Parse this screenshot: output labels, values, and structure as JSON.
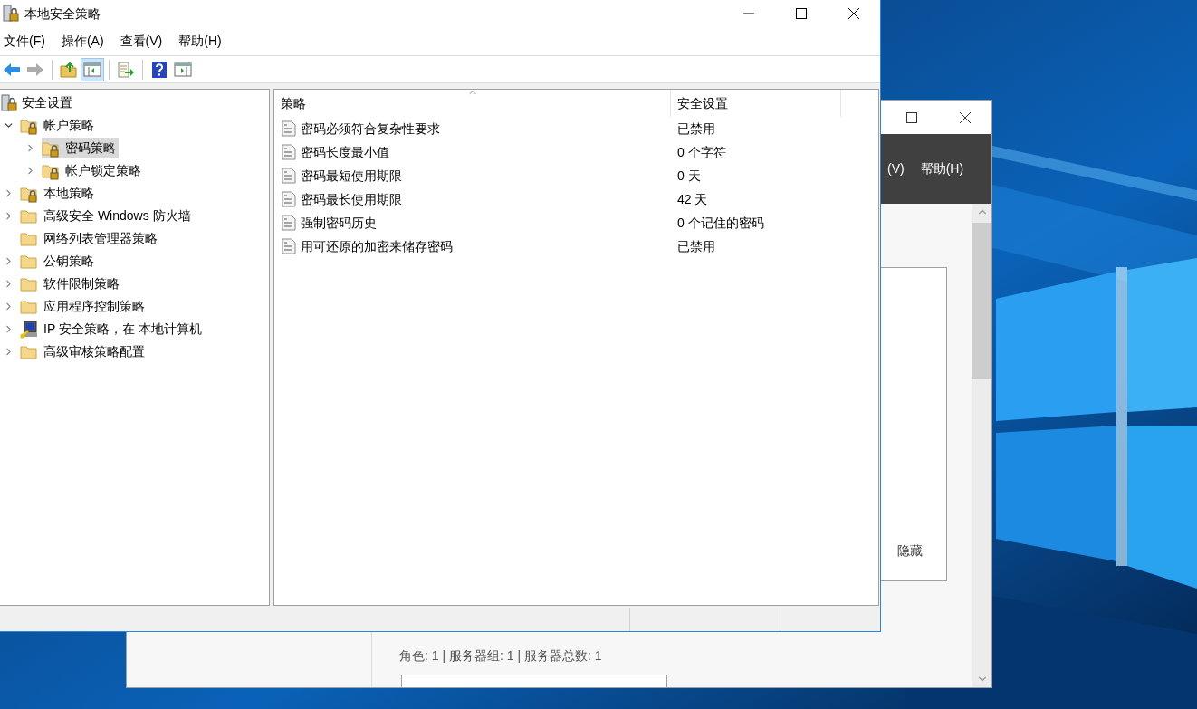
{
  "window": {
    "title": "本地安全策略"
  },
  "menu": [
    "文件(F)",
    "操作(A)",
    "查看(V)",
    "帮助(H)"
  ],
  "toolbar": [
    {
      "kind": "back",
      "disabled": false,
      "selected": false
    },
    {
      "kind": "forward",
      "disabled": true,
      "selected": false
    },
    {
      "kind": "separator"
    },
    {
      "kind": "up",
      "disabled": false,
      "selected": false
    },
    {
      "kind": "tree",
      "disabled": false,
      "selected": true
    },
    {
      "kind": "separator"
    },
    {
      "kind": "export",
      "disabled": false,
      "selected": false
    },
    {
      "kind": "separator"
    },
    {
      "kind": "help",
      "disabled": false,
      "selected": false
    },
    {
      "kind": "pane",
      "disabled": false,
      "selected": false
    }
  ],
  "tree": {
    "root": {
      "label": "安全设置",
      "kind": "server"
    },
    "items": [
      {
        "label": "帐户策略",
        "kind": "lock-folder",
        "expandable": true,
        "expanded": true,
        "selected": false,
        "children": [
          {
            "label": "密码策略",
            "kind": "lock-folder",
            "expandable": true,
            "expanded": false,
            "selected": true
          },
          {
            "label": "帐户锁定策略",
            "kind": "lock-folder",
            "expandable": true,
            "expanded": false,
            "selected": false
          }
        ]
      },
      {
        "label": "本地策略",
        "kind": "lock-folder",
        "expandable": true,
        "expanded": false,
        "selected": false
      },
      {
        "label": "高级安全 Windows 防火墙",
        "kind": "folder",
        "expandable": true,
        "expanded": false,
        "selected": false
      },
      {
        "label": "网络列表管理器策略",
        "kind": "folder",
        "expandable": false,
        "selected": false
      },
      {
        "label": "公钥策略",
        "kind": "folder",
        "expandable": true,
        "expanded": false,
        "selected": false
      },
      {
        "label": "软件限制策略",
        "kind": "folder",
        "expandable": true,
        "expanded": false,
        "selected": false
      },
      {
        "label": "应用程序控制策略",
        "kind": "folder",
        "expandable": true,
        "expanded": false,
        "selected": false
      },
      {
        "label": "IP 安全策略，在 本地计算机",
        "kind": "network",
        "expandable": true,
        "expanded": false,
        "selected": false
      },
      {
        "label": "高级审核策略配置",
        "kind": "folder",
        "expandable": true,
        "expanded": false,
        "selected": false
      }
    ]
  },
  "list": {
    "columns": [
      {
        "label": "策略",
        "sorted": true
      },
      {
        "label": "安全设置",
        "sorted": false
      }
    ],
    "rows": [
      {
        "policy": "密码必须符合复杂性要求",
        "setting": "已禁用"
      },
      {
        "policy": "密码长度最小值",
        "setting": "0 个字符"
      },
      {
        "policy": "密码最短使用期限",
        "setting": "0 天"
      },
      {
        "policy": "密码最长使用期限",
        "setting": "42 天"
      },
      {
        "policy": "强制密码历史",
        "setting": "0 个记住的密码"
      },
      {
        "policy": "用可还原的加密来储存密码",
        "setting": "已禁用"
      }
    ]
  },
  "background_window": {
    "menu": [
      "(V)",
      "帮助(H)"
    ],
    "card_button": "隐藏",
    "section_summary": "角色: 1 | 服务器组: 1 | 服务器总数: 1"
  }
}
